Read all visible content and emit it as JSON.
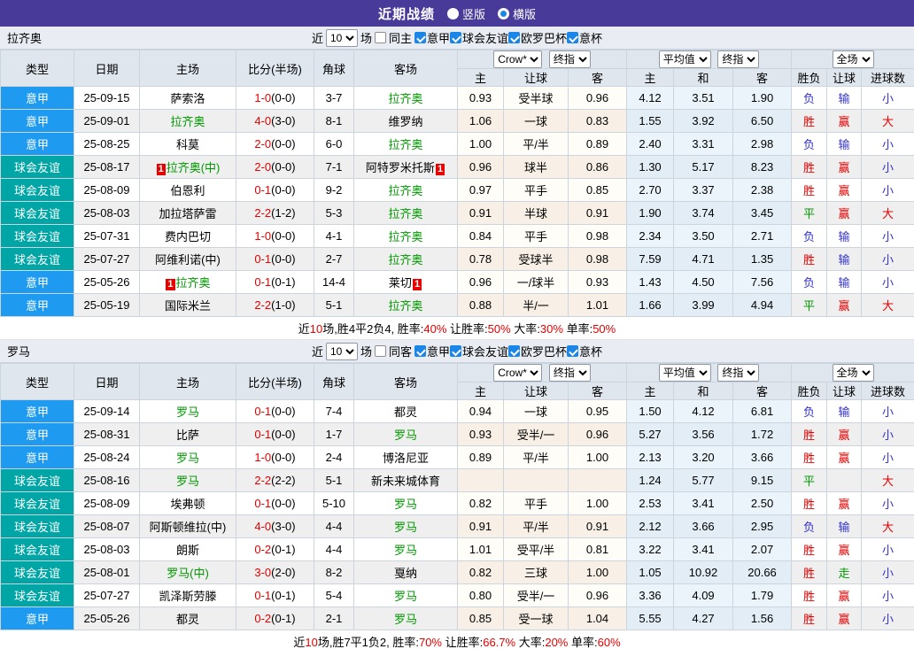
{
  "title_bar": {
    "title": "近期战绩",
    "radios": [
      {
        "label": "竖版",
        "selected": false
      },
      {
        "label": "横版",
        "selected": true
      }
    ]
  },
  "filter_labels": {
    "near": "近",
    "unit": "场"
  },
  "table_headers": {
    "type": "类型",
    "date": "日期",
    "home": "主场",
    "score": "比分(半场)",
    "corner": "角球",
    "away": "客场",
    "hdp_home": "主",
    "hdp_line": "让球",
    "hdp_away": "客",
    "eu_home": "主",
    "eu_draw": "和",
    "eu_away": "客",
    "result": "胜负",
    "hdp_result": "让球",
    "goals": "进球数"
  },
  "colors": {
    "header_purple": "#483a99",
    "league_serie_a": "#1e9bf0",
    "league_friendly": "#00a6a6",
    "team_highlight": "#009900",
    "win_red": "#e60000",
    "lose_blue": "#3333cc",
    "draw_green": "#009900"
  },
  "sections": [
    {
      "team": "拉齐奥",
      "filter": {
        "count": "10",
        "venue": {
          "label": "同主",
          "checked": false
        },
        "competitions": [
          {
            "label": "意甲",
            "checked": true
          },
          {
            "label": "球会友谊",
            "checked": true
          },
          {
            "label": "欧罗巴杯",
            "checked": true
          },
          {
            "label": "意杯",
            "checked": true
          }
        ]
      },
      "selectors": {
        "hdp_company": "Crow*",
        "hdp_time": "终指",
        "eu_company": "平均值",
        "eu_time": "终指",
        "scope": "全场"
      },
      "rows": [
        {
          "league": "意甲",
          "type": "a",
          "date": "25-09-15",
          "home": {
            "name": "萨索洛",
            "green": false,
            "badge": false
          },
          "score": "1-0",
          "half": "(0-0)",
          "corners": "3-7",
          "away": {
            "name": "拉齐奥",
            "green": true,
            "badge": false
          },
          "hdp": [
            "0.93",
            "受半球",
            "0.96"
          ],
          "eu": [
            "4.12",
            "3.51",
            "1.90"
          ],
          "res": [
            [
              "负",
              "b"
            ],
            [
              "输",
              "b"
            ],
            [
              "小",
              "b"
            ]
          ]
        },
        {
          "league": "意甲",
          "type": "a",
          "date": "25-09-01",
          "home": {
            "name": "拉齐奥",
            "green": true,
            "badge": false
          },
          "score": "4-0",
          "half": "(3-0)",
          "corners": "8-1",
          "away": {
            "name": "维罗纳",
            "green": false,
            "badge": false
          },
          "hdp": [
            "1.06",
            "一球",
            "0.83"
          ],
          "eu": [
            "1.55",
            "3.92",
            "6.50"
          ],
          "res": [
            [
              "胜",
              "r"
            ],
            [
              "赢",
              "r"
            ],
            [
              "大",
              "r"
            ]
          ]
        },
        {
          "league": "意甲",
          "type": "a",
          "date": "25-08-25",
          "home": {
            "name": "科莫",
            "green": false,
            "badge": false
          },
          "score": "2-0",
          "half": "(0-0)",
          "corners": "6-0",
          "away": {
            "name": "拉齐奥",
            "green": true,
            "badge": false
          },
          "hdp": [
            "1.00",
            "平/半",
            "0.89"
          ],
          "eu": [
            "2.40",
            "3.31",
            "2.98"
          ],
          "res": [
            [
              "负",
              "b"
            ],
            [
              "输",
              "b"
            ],
            [
              "小",
              "b"
            ]
          ]
        },
        {
          "league": "球会友谊",
          "type": "f",
          "date": "25-08-17",
          "home": {
            "name": "拉齐奥(中)",
            "green": true,
            "badge": true
          },
          "score": "2-0",
          "half": "(0-0)",
          "corners": "7-1",
          "away": {
            "name": "阿特罗米托斯",
            "green": false,
            "badge": true
          },
          "hdp": [
            "0.96",
            "球半",
            "0.86"
          ],
          "eu": [
            "1.30",
            "5.17",
            "8.23"
          ],
          "res": [
            [
              "胜",
              "r"
            ],
            [
              "赢",
              "r"
            ],
            [
              "小",
              "b"
            ]
          ]
        },
        {
          "league": "球会友谊",
          "type": "f",
          "date": "25-08-09",
          "home": {
            "name": "伯恩利",
            "green": false,
            "badge": false
          },
          "score": "0-1",
          "half": "(0-0)",
          "corners": "9-2",
          "away": {
            "name": "拉齐奥",
            "green": true,
            "badge": false
          },
          "hdp": [
            "0.97",
            "平手",
            "0.85"
          ],
          "eu": [
            "2.70",
            "3.37",
            "2.38"
          ],
          "res": [
            [
              "胜",
              "r"
            ],
            [
              "赢",
              "r"
            ],
            [
              "小",
              "b"
            ]
          ]
        },
        {
          "league": "球会友谊",
          "type": "f",
          "date": "25-08-03",
          "home": {
            "name": "加拉塔萨雷",
            "green": false,
            "badge": false
          },
          "score": "2-2",
          "half": "(1-2)",
          "corners": "5-3",
          "away": {
            "name": "拉齐奥",
            "green": true,
            "badge": false
          },
          "hdp": [
            "0.91",
            "半球",
            "0.91"
          ],
          "eu": [
            "1.90",
            "3.74",
            "3.45"
          ],
          "res": [
            [
              "平",
              "g"
            ],
            [
              "赢",
              "r"
            ],
            [
              "大",
              "r"
            ]
          ]
        },
        {
          "league": "球会友谊",
          "type": "f",
          "date": "25-07-31",
          "home": {
            "name": "费内巴切",
            "green": false,
            "badge": false
          },
          "score": "1-0",
          "half": "(0-0)",
          "corners": "4-1",
          "away": {
            "name": "拉齐奥",
            "green": true,
            "badge": false
          },
          "hdp": [
            "0.84",
            "平手",
            "0.98"
          ],
          "eu": [
            "2.34",
            "3.50",
            "2.71"
          ],
          "res": [
            [
              "负",
              "b"
            ],
            [
              "输",
              "b"
            ],
            [
              "小",
              "b"
            ]
          ]
        },
        {
          "league": "球会友谊",
          "type": "f",
          "date": "25-07-27",
          "home": {
            "name": "阿维利诺(中)",
            "green": false,
            "badge": false
          },
          "score": "0-1",
          "half": "(0-0)",
          "corners": "2-7",
          "away": {
            "name": "拉齐奥",
            "green": true,
            "badge": false
          },
          "hdp": [
            "0.78",
            "受球半",
            "0.98"
          ],
          "eu": [
            "7.59",
            "4.71",
            "1.35"
          ],
          "res": [
            [
              "胜",
              "r"
            ],
            [
              "输",
              "b"
            ],
            [
              "小",
              "b"
            ]
          ]
        },
        {
          "league": "意甲",
          "type": "a",
          "date": "25-05-26",
          "home": {
            "name": "拉齐奥",
            "green": true,
            "badge": true
          },
          "score": "0-1",
          "half": "(0-1)",
          "corners": "14-4",
          "away": {
            "name": "莱切",
            "green": false,
            "badge": true
          },
          "hdp": [
            "0.96",
            "一/球半",
            "0.93"
          ],
          "eu": [
            "1.43",
            "4.50",
            "7.56"
          ],
          "res": [
            [
              "负",
              "b"
            ],
            [
              "输",
              "b"
            ],
            [
              "小",
              "b"
            ]
          ]
        },
        {
          "league": "意甲",
          "type": "a",
          "date": "25-05-19",
          "home": {
            "name": "国际米兰",
            "green": false,
            "badge": false
          },
          "score": "2-2",
          "half": "(1-0)",
          "corners": "5-1",
          "away": {
            "name": "拉齐奥",
            "green": true,
            "badge": false
          },
          "hdp": [
            "0.88",
            "半/一",
            "1.01"
          ],
          "eu": [
            "1.66",
            "3.99",
            "4.94"
          ],
          "res": [
            [
              "平",
              "g"
            ],
            [
              "赢",
              "r"
            ],
            [
              "大",
              "r"
            ]
          ]
        }
      ],
      "summary": [
        [
          "近",
          "k"
        ],
        [
          "10",
          "r"
        ],
        [
          "场,胜4平2负4, 胜率:",
          "k"
        ],
        [
          "40%",
          "r"
        ],
        [
          " 让胜率:",
          "k"
        ],
        [
          "50%",
          "r"
        ],
        [
          " 大率:",
          "k"
        ],
        [
          "30%",
          "r"
        ],
        [
          " 单率:",
          "k"
        ],
        [
          "50%",
          "r"
        ]
      ]
    },
    {
      "team": "罗马",
      "filter": {
        "count": "10",
        "venue": {
          "label": "同客",
          "checked": false
        },
        "competitions": [
          {
            "label": "意甲",
            "checked": true
          },
          {
            "label": "球会友谊",
            "checked": true
          },
          {
            "label": "欧罗巴杯",
            "checked": true
          },
          {
            "label": "意杯",
            "checked": true
          }
        ]
      },
      "selectors": {
        "hdp_company": "Crow*",
        "hdp_time": "终指",
        "eu_company": "平均值",
        "eu_time": "终指",
        "scope": "全场"
      },
      "rows": [
        {
          "league": "意甲",
          "type": "a",
          "date": "25-09-14",
          "home": {
            "name": "罗马",
            "green": true,
            "badge": false
          },
          "score": "0-1",
          "half": "(0-0)",
          "corners": "7-4",
          "away": {
            "name": "都灵",
            "green": false,
            "badge": false
          },
          "hdp": [
            "0.94",
            "一球",
            "0.95"
          ],
          "eu": [
            "1.50",
            "4.12",
            "6.81"
          ],
          "res": [
            [
              "负",
              "b"
            ],
            [
              "输",
              "b"
            ],
            [
              "小",
              "b"
            ]
          ]
        },
        {
          "league": "意甲",
          "type": "a",
          "date": "25-08-31",
          "home": {
            "name": "比萨",
            "green": false,
            "badge": false
          },
          "score": "0-1",
          "half": "(0-0)",
          "corners": "1-7",
          "away": {
            "name": "罗马",
            "green": true,
            "badge": false
          },
          "hdp": [
            "0.93",
            "受半/一",
            "0.96"
          ],
          "eu": [
            "5.27",
            "3.56",
            "1.72"
          ],
          "res": [
            [
              "胜",
              "r"
            ],
            [
              "赢",
              "r"
            ],
            [
              "小",
              "b"
            ]
          ]
        },
        {
          "league": "意甲",
          "type": "a",
          "date": "25-08-24",
          "home": {
            "name": "罗马",
            "green": true,
            "badge": false
          },
          "score": "1-0",
          "half": "(0-0)",
          "corners": "2-4",
          "away": {
            "name": "博洛尼亚",
            "green": false,
            "badge": false
          },
          "hdp": [
            "0.89",
            "平/半",
            "1.00"
          ],
          "eu": [
            "2.13",
            "3.20",
            "3.66"
          ],
          "res": [
            [
              "胜",
              "r"
            ],
            [
              "赢",
              "r"
            ],
            [
              "小",
              "b"
            ]
          ]
        },
        {
          "league": "球会友谊",
          "type": "f",
          "date": "25-08-16",
          "home": {
            "name": "罗马",
            "green": true,
            "badge": false
          },
          "score": "2-2",
          "half": "(2-2)",
          "corners": "5-1",
          "away": {
            "name": "新未来城体育",
            "green": false,
            "badge": false
          },
          "hdp": [
            "",
            "",
            ""
          ],
          "eu": [
            "1.24",
            "5.77",
            "9.15"
          ],
          "res": [
            [
              "平",
              "g"
            ],
            [
              "",
              ""
            ],
            [
              "大",
              "r"
            ]
          ]
        },
        {
          "league": "球会友谊",
          "type": "f",
          "date": "25-08-09",
          "home": {
            "name": "埃弗顿",
            "green": false,
            "badge": false
          },
          "score": "0-1",
          "half": "(0-0)",
          "corners": "5-10",
          "away": {
            "name": "罗马",
            "green": true,
            "badge": false
          },
          "hdp": [
            "0.82",
            "平手",
            "1.00"
          ],
          "eu": [
            "2.53",
            "3.41",
            "2.50"
          ],
          "res": [
            [
              "胜",
              "r"
            ],
            [
              "赢",
              "r"
            ],
            [
              "小",
              "b"
            ]
          ]
        },
        {
          "league": "球会友谊",
          "type": "f",
          "date": "25-08-07",
          "home": {
            "name": "阿斯顿维拉(中)",
            "green": false,
            "badge": false
          },
          "score": "4-0",
          "half": "(3-0)",
          "corners": "4-4",
          "away": {
            "name": "罗马",
            "green": true,
            "badge": false
          },
          "hdp": [
            "0.91",
            "平/半",
            "0.91"
          ],
          "eu": [
            "2.12",
            "3.66",
            "2.95"
          ],
          "res": [
            [
              "负",
              "b"
            ],
            [
              "输",
              "b"
            ],
            [
              "大",
              "r"
            ]
          ]
        },
        {
          "league": "球会友谊",
          "type": "f",
          "date": "25-08-03",
          "home": {
            "name": "朗斯",
            "green": false,
            "badge": false
          },
          "score": "0-2",
          "half": "(0-1)",
          "corners": "4-4",
          "away": {
            "name": "罗马",
            "green": true,
            "badge": false
          },
          "hdp": [
            "1.01",
            "受平/半",
            "0.81"
          ],
          "eu": [
            "3.22",
            "3.41",
            "2.07"
          ],
          "res": [
            [
              "胜",
              "r"
            ],
            [
              "赢",
              "r"
            ],
            [
              "小",
              "b"
            ]
          ]
        },
        {
          "league": "球会友谊",
          "type": "f",
          "date": "25-08-01",
          "home": {
            "name": "罗马(中)",
            "green": true,
            "badge": false
          },
          "score": "3-0",
          "half": "(2-0)",
          "corners": "8-2",
          "away": {
            "name": "戛纳",
            "green": false,
            "badge": false
          },
          "hdp": [
            "0.82",
            "三球",
            "1.00"
          ],
          "eu": [
            "1.05",
            "10.92",
            "20.66"
          ],
          "res": [
            [
              "胜",
              "r"
            ],
            [
              "走",
              "g"
            ],
            [
              "小",
              "b"
            ]
          ]
        },
        {
          "league": "球会友谊",
          "type": "f",
          "date": "25-07-27",
          "home": {
            "name": "凯泽斯劳滕",
            "green": false,
            "badge": false
          },
          "score": "0-1",
          "half": "(0-1)",
          "corners": "5-4",
          "away": {
            "name": "罗马",
            "green": true,
            "badge": false
          },
          "hdp": [
            "0.80",
            "受半/一",
            "0.96"
          ],
          "eu": [
            "3.36",
            "4.09",
            "1.79"
          ],
          "res": [
            [
              "胜",
              "r"
            ],
            [
              "赢",
              "r"
            ],
            [
              "小",
              "b"
            ]
          ]
        },
        {
          "league": "意甲",
          "type": "a",
          "date": "25-05-26",
          "home": {
            "name": "都灵",
            "green": false,
            "badge": false
          },
          "score": "0-2",
          "half": "(0-1)",
          "corners": "2-1",
          "away": {
            "name": "罗马",
            "green": true,
            "badge": false
          },
          "hdp": [
            "0.85",
            "受一球",
            "1.04"
          ],
          "eu": [
            "5.55",
            "4.27",
            "1.56"
          ],
          "res": [
            [
              "胜",
              "r"
            ],
            [
              "赢",
              "r"
            ],
            [
              "小",
              "b"
            ]
          ]
        }
      ],
      "summary": [
        [
          "近",
          "k"
        ],
        [
          "10",
          "r"
        ],
        [
          "场,胜7平1负2, 胜率:",
          "k"
        ],
        [
          "70%",
          "r"
        ],
        [
          " 让胜率:",
          "k"
        ],
        [
          "66.7%",
          "r"
        ],
        [
          " 大率:",
          "k"
        ],
        [
          "20%",
          "r"
        ],
        [
          " 单率:",
          "k"
        ],
        [
          "60%",
          "r"
        ]
      ]
    }
  ]
}
